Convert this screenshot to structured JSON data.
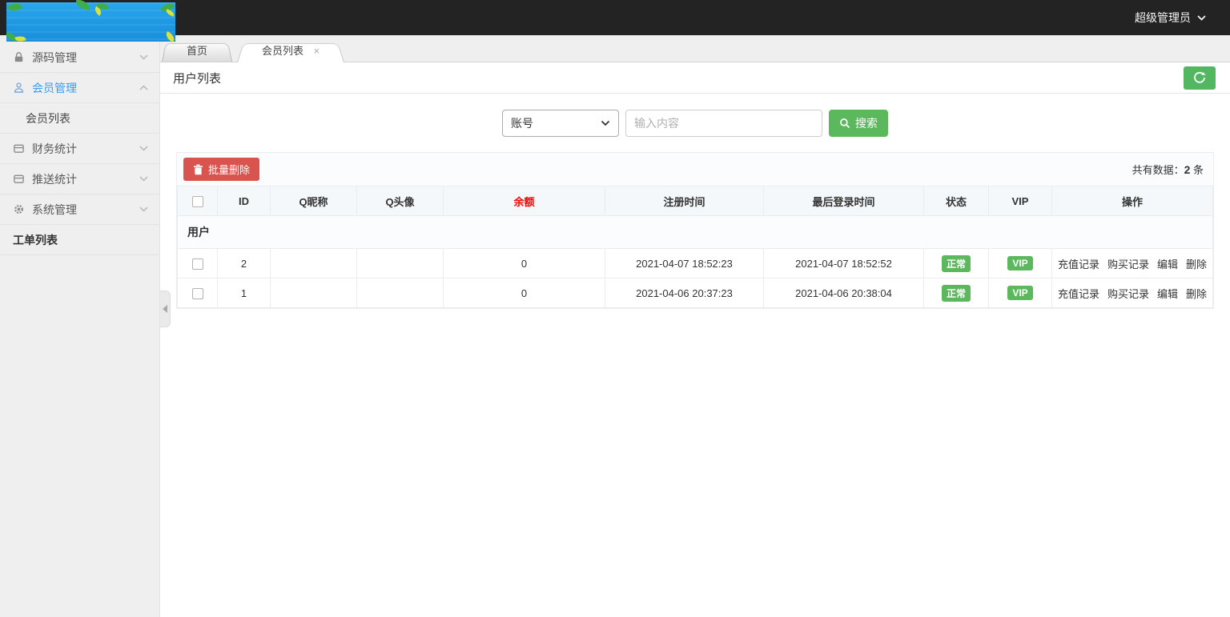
{
  "topbar": {
    "user_menu": "超级管理员"
  },
  "sidebar": {
    "items": [
      {
        "label": "源码管理"
      },
      {
        "label": "会员管理"
      },
      {
        "label": "会员列表"
      },
      {
        "label": "财务统计"
      },
      {
        "label": "推送统计"
      },
      {
        "label": "系统管理"
      },
      {
        "label": "工单列表"
      }
    ]
  },
  "tabs": [
    {
      "label": "首页"
    },
    {
      "label": "会员列表"
    }
  ],
  "icons": {
    "close": "×"
  },
  "page": {
    "title": "用户列表"
  },
  "search": {
    "field_selected": "账号",
    "input_placeholder": "输入内容",
    "button_label": "搜索"
  },
  "toolbar": {
    "batch_delete_label": "批量删除",
    "total_prefix": "共有数据：",
    "total_count": "2",
    "total_suffix": " 条"
  },
  "table": {
    "group_header": "用户",
    "columns": [
      "ID",
      "Q昵称",
      "Q头像",
      "余额",
      "注册时间",
      "最后登录时间",
      "状态",
      "VIP",
      "操作"
    ],
    "rows": [
      {
        "id": "2",
        "q_nickname": "",
        "q_avatar": "",
        "balance": "0",
        "register_time": "2021-04-07 18:52:23",
        "last_login_time": "2021-04-07 18:52:52",
        "status": "正常",
        "vip": "VIP",
        "actions": [
          "充值记录",
          "购买记录",
          "编辑",
          "删除"
        ]
      },
      {
        "id": "1",
        "q_nickname": "",
        "q_avatar": "",
        "balance": "0",
        "register_time": "2021-04-06 20:37:23",
        "last_login_time": "2021-04-06 20:38:04",
        "status": "正常",
        "vip": "VIP",
        "actions": [
          "充值记录",
          "购买记录",
          "编辑",
          "删除"
        ]
      }
    ]
  },
  "colors": {
    "accent_green": "#5cb85c",
    "danger_red": "#d9534f",
    "active_blue": "#3a9cf0",
    "balance_header_red": "#ff0000",
    "topbar_dark": "#232323",
    "logo_blue": "#1f98e2"
  }
}
